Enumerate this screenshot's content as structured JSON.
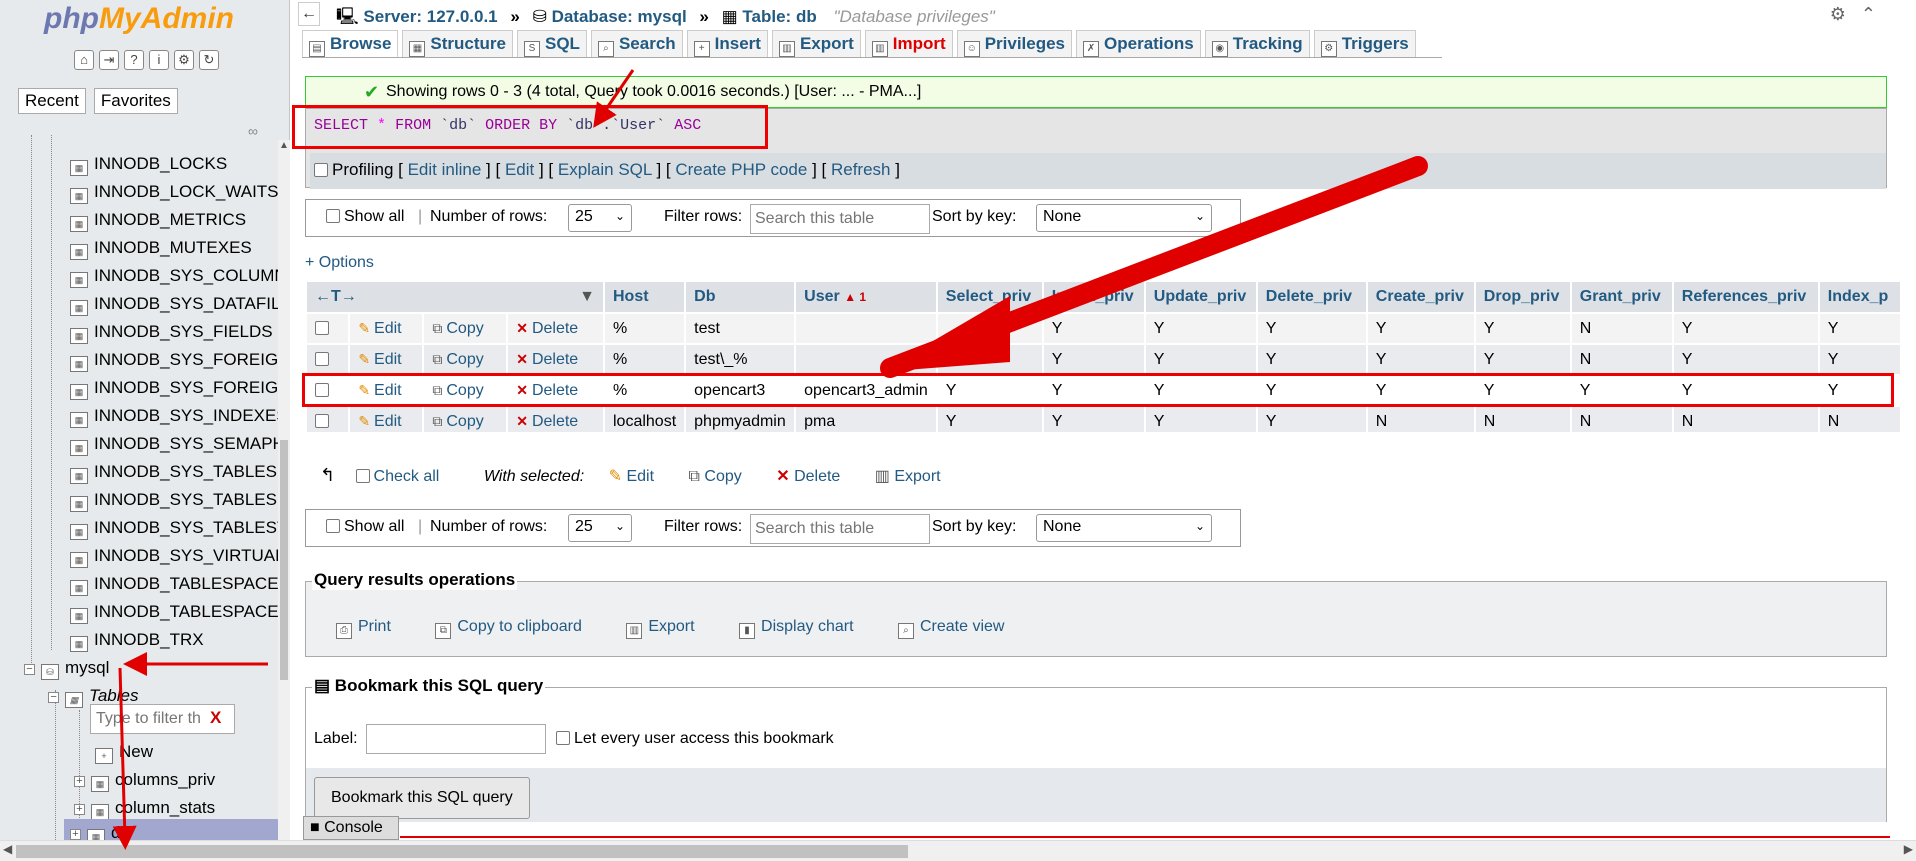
{
  "sidebar": {
    "logo_php": "php",
    "logo_myadmin": "MyAdmin",
    "tabs": [
      "Recent",
      "Favorites"
    ],
    "tree_items": [
      "INNODB_LOCKS",
      "INNODB_LOCK_WAITS",
      "INNODB_METRICS",
      "INNODB_MUTEXES",
      "INNODB_SYS_COLUMN",
      "INNODB_SYS_DATAFILI",
      "INNODB_SYS_FIELDS",
      "INNODB_SYS_FOREIGN",
      "INNODB_SYS_FOREIGN",
      "INNODB_SYS_INDEXES",
      "INNODB_SYS_SEMAPH",
      "INNODB_SYS_TABLES",
      "INNODB_SYS_TABLESF",
      "INNODB_SYS_TABLEST",
      "INNODB_SYS_VIRTUAL",
      "INNODB_TABLESPACES",
      "INNODB_TABLESPACES",
      "INNODB_TRX"
    ],
    "db_name": "mysql",
    "tables_label": "Tables",
    "filter_placeholder": "Type to filter th",
    "filter_clear": "X",
    "new_label": "New",
    "table_items": [
      "columns_priv",
      "column_stats",
      "db"
    ]
  },
  "topbar": {
    "server_label": "Server: 127.0.0.1",
    "database_label": "Database: mysql",
    "table_label": "Table: db",
    "table_comment": "\"Database privileges\""
  },
  "menu": [
    "Browse",
    "Structure",
    "SQL",
    "Search",
    "Insert",
    "Export",
    "Import",
    "Privileges",
    "Operations",
    "Tracking",
    "Triggers"
  ],
  "message": {
    "success": "Showing rows 0 - 3 (4 total, Query took 0.0016 seconds.) [User: ... - PMA...]"
  },
  "sql": {
    "select": "SELECT",
    "star": "*",
    "from": "FROM",
    "table": "`db`",
    "order_by": "ORDER BY",
    "col": "`db`.`User`",
    "asc": "ASC",
    "profiling": "Profiling",
    "links": [
      "Edit inline",
      "Edit",
      "Explain SQL",
      "Create PHP code",
      "Refresh"
    ]
  },
  "navbar": {
    "show_all": "Show all",
    "num_rows_label": "Number of rows:",
    "num_rows_value": "25",
    "filter_label": "Filter rows:",
    "filter_placeholder": "Search this table",
    "sort_label": "Sort by key:",
    "sort_value": "None"
  },
  "options_link": "+ Options",
  "table": {
    "columns": [
      "Host",
      "Db",
      "User",
      "Select_priv",
      "Insert_priv",
      "Update_priv",
      "Delete_priv",
      "Create_priv",
      "Drop_priv",
      "Grant_priv",
      "References_priv",
      "Index_p"
    ],
    "user_sort_indicator": "▲ 1",
    "action_edit": "Edit",
    "action_copy": "Copy",
    "action_delete": "Delete",
    "rows": [
      {
        "host": "%",
        "db": "test",
        "user": "",
        "vals": [
          "",
          "Y",
          "Y",
          "Y",
          "Y",
          "Y",
          "N",
          "Y",
          "Y"
        ]
      },
      {
        "host": "%",
        "db": "test\\_%",
        "user": "",
        "vals": [
          "",
          "Y",
          "Y",
          "Y",
          "Y",
          "Y",
          "N",
          "Y",
          "Y"
        ]
      },
      {
        "host": "%",
        "db": "opencart3",
        "user": "opencart3_admin",
        "vals": [
          "Y",
          "Y",
          "Y",
          "Y",
          "Y",
          "Y",
          "Y",
          "Y",
          "Y"
        ]
      },
      {
        "host": "localhost",
        "db": "phpmyadmin",
        "user": "pma",
        "vals": [
          "Y",
          "Y",
          "Y",
          "Y",
          "N",
          "N",
          "N",
          "N",
          "N"
        ]
      }
    ]
  },
  "with_selected": {
    "check_all": "Check all",
    "label": "With selected:",
    "edit": "Edit",
    "copy": "Copy",
    "delete": "Delete",
    "export": "Export"
  },
  "query_ops": {
    "legend": "Query results operations",
    "print": "Print",
    "copy_clipboard": "Copy to clipboard",
    "export": "Export",
    "display_chart": "Display chart",
    "create_view": "Create view"
  },
  "bookmark": {
    "legend": "Bookmark this SQL query",
    "label": "Label:",
    "let_every_user": "Let every user access this bookmark",
    "button": "Bookmark this SQL query"
  },
  "console_label": "Console",
  "colors": {
    "annotation_red": "#e00000",
    "link_blue": "#235a81"
  }
}
